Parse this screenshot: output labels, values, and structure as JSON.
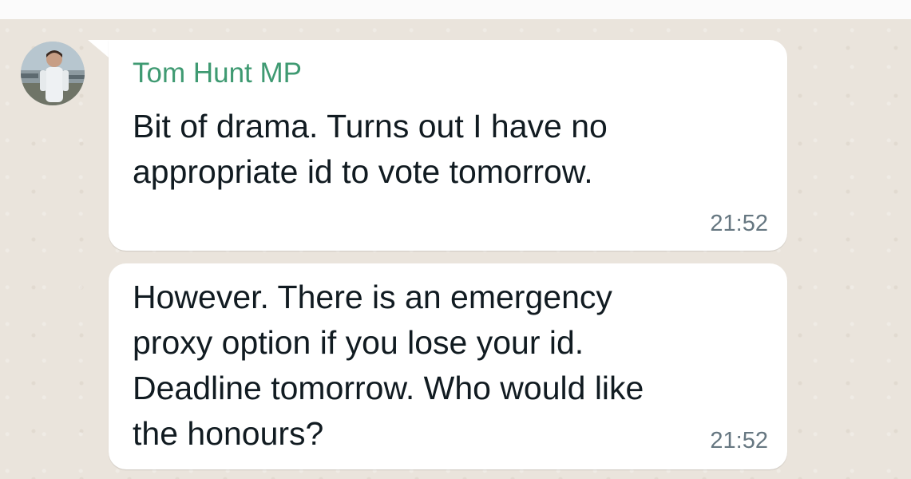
{
  "chat": {
    "messages": [
      {
        "sender": "Tom Hunt MP",
        "text": "Bit of drama. Turns out I have no\nappropriate id to vote tomorrow.",
        "time": "21:52"
      },
      {
        "text": "However. There is an emergency\nproxy option if you lose your id.\nDeadline tomorrow. Who would like\nthe honours?",
        "time": "21:52"
      }
    ]
  },
  "colors": {
    "sender_name": "#3f9a72",
    "bubble": "#ffffff",
    "wallpaper": "#eae4dc",
    "timestamp": "#667781"
  }
}
